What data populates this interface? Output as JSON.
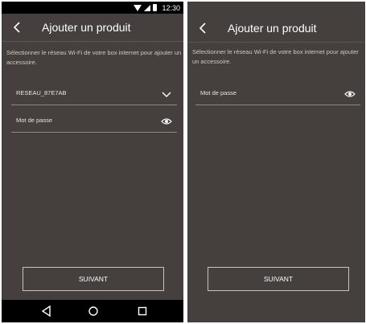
{
  "left_screen": {
    "status_bar": {
      "time": "12:30",
      "icons": [
        "wifi-icon",
        "signal-icon",
        "battery-icon"
      ]
    },
    "app_bar": {
      "back_icon": "chevron-left-icon",
      "title": "Ajouter un produit"
    },
    "instruction": "Sélectionner le réseau Wi-Fi de votre box internet pour ajouter un accessoire.",
    "network_field": {
      "value": "RESEAU_87E7AB",
      "icon": "chevron-down-icon"
    },
    "password_field": {
      "placeholder": "Mot de passe",
      "icon": "eye-icon"
    },
    "next_button": "SUIVANT",
    "nav_bar": {
      "buttons": [
        "back-triangle-icon",
        "home-circle-icon",
        "recents-square-icon"
      ]
    }
  },
  "right_screen": {
    "app_bar": {
      "back_icon": "chevron-left-icon",
      "title": "Ajouter un produit"
    },
    "instruction": "Sélectionner le réseau Wi-Fi de votre box internet pour ajouter un accessoire.",
    "password_field": {
      "placeholder": "Mot de passe",
      "icon": "eye-icon"
    },
    "next_button": "SUIVANT"
  },
  "colors": {
    "background": "#45403d",
    "divider": "#5c5653",
    "field_underline": "#8f8985",
    "text_primary": "#ffffff",
    "text_secondary": "#cfc9c5",
    "system_bar": "#000000"
  }
}
